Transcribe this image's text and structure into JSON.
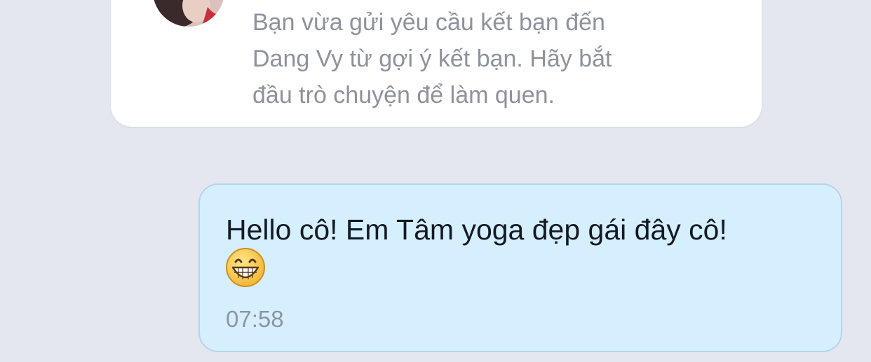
{
  "system_notice": {
    "line1": "Bạn vừa gửi yêu cầu kết bạn đến",
    "line2": "Dang Vy từ gợi ý kết bạn. Hãy bắt",
    "line3": "đầu trò chuyện để làm quen."
  },
  "message": {
    "text": "Hello cô! Em Tâm yoga đẹp gái đây cô!",
    "emoji": "grinning-face-emoji",
    "time": "07:58"
  },
  "colors": {
    "background": "#e4e7f0",
    "card": "#ffffff",
    "bubble": "#d5efff",
    "bubble_border": "#b6d4ea",
    "muted_text": "#8d929c"
  }
}
